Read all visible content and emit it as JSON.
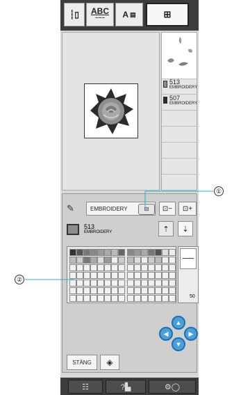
{
  "toolbar": {
    "mode_abc": "ABC",
    "mode_alpha": "A",
    "icons": [
      "utility-stitch-icon",
      "character-stitch-icon",
      "alphabet-icon",
      "embroidery-icon"
    ]
  },
  "color_list": [
    {
      "number": "513",
      "name": "EMBROIDERY",
      "color": "#8e8e8e"
    },
    {
      "number": "507",
      "name": "EMBROIDERY",
      "color": "#2c2c2c"
    }
  ],
  "thread_panel": {
    "brand_label": "EMBROIDERY",
    "current_number": "513",
    "current_name": "EMBROIDERY",
    "side_count": "50"
  },
  "buttons": {
    "close_label": "STÄNG"
  },
  "callouts": {
    "one": "①",
    "two": "②"
  },
  "colors": {
    "accent_blue": "#3fa3dd",
    "callout_line": "#1ab3d9"
  }
}
